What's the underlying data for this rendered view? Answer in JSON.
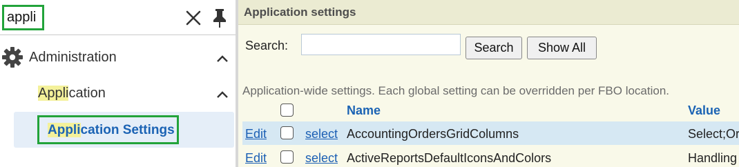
{
  "sidebar": {
    "search": {
      "value": "appli",
      "placeholder": ""
    },
    "nav": {
      "administration": {
        "label": "Administration"
      },
      "application": {
        "label_highlight": "Appli",
        "label_rest": "cation"
      },
      "application_settings": {
        "label_highlight": "Appli",
        "label_rest": "cation Settings"
      }
    },
    "icons": {
      "clear": "close-icon",
      "pin": "pin-icon",
      "admin": "gear-icon",
      "expand": "chevron-up-icon"
    }
  },
  "main": {
    "title": "Application settings",
    "search": {
      "label": "Search:",
      "value": "",
      "placeholder": ""
    },
    "buttons": {
      "search": "Search",
      "show_all": "Show All"
    },
    "description": "Application-wide settings. Each global setting can be overridden per FBO location.",
    "table": {
      "columns": {
        "name": "Name",
        "value": "Value"
      },
      "rows": [
        {
          "edit": "Edit",
          "select": "select",
          "name": "AccountingOrdersGridColumns",
          "value": "Select;Or"
        },
        {
          "edit": "Edit",
          "select": "select",
          "name": "ActiveReportsDefaultIconsAndColors",
          "value": "Handling"
        }
      ]
    }
  },
  "colors": {
    "highlight_border": "#22a33a",
    "search_highlight": "#f4f19a",
    "link": "#1b5fb4",
    "selected_row": "#d6e8f3",
    "panel_header": "#ebebd2",
    "panel_bg": "#f9f9e9",
    "sidebar_selected": "#e5eef8"
  }
}
